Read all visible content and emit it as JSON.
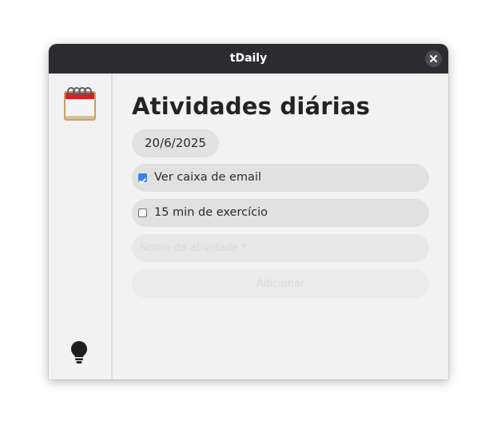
{
  "window": {
    "title": "tDaily",
    "close_icon": "close-icon"
  },
  "sidebar": {
    "app_icon": "calendar-notepad-icon",
    "bottom_icon": "lightbulb-icon"
  },
  "main": {
    "heading": "Atividades diárias",
    "date": "20/6/2025",
    "tasks": [
      {
        "label": "Ver caixa de email",
        "checked": true
      },
      {
        "label": "15 min de exercício",
        "checked": false
      }
    ],
    "new_task": {
      "placeholder": "Nome da atividade *",
      "value": ""
    },
    "add_button_label": "Adicionar"
  },
  "colors": {
    "titlebar": "#2b2b30",
    "window_bg": "#f2f2f2",
    "pill_bg": "#e1e1e1",
    "checkbox_accent": "#3584e4",
    "calendar_red": "#e01b24"
  }
}
